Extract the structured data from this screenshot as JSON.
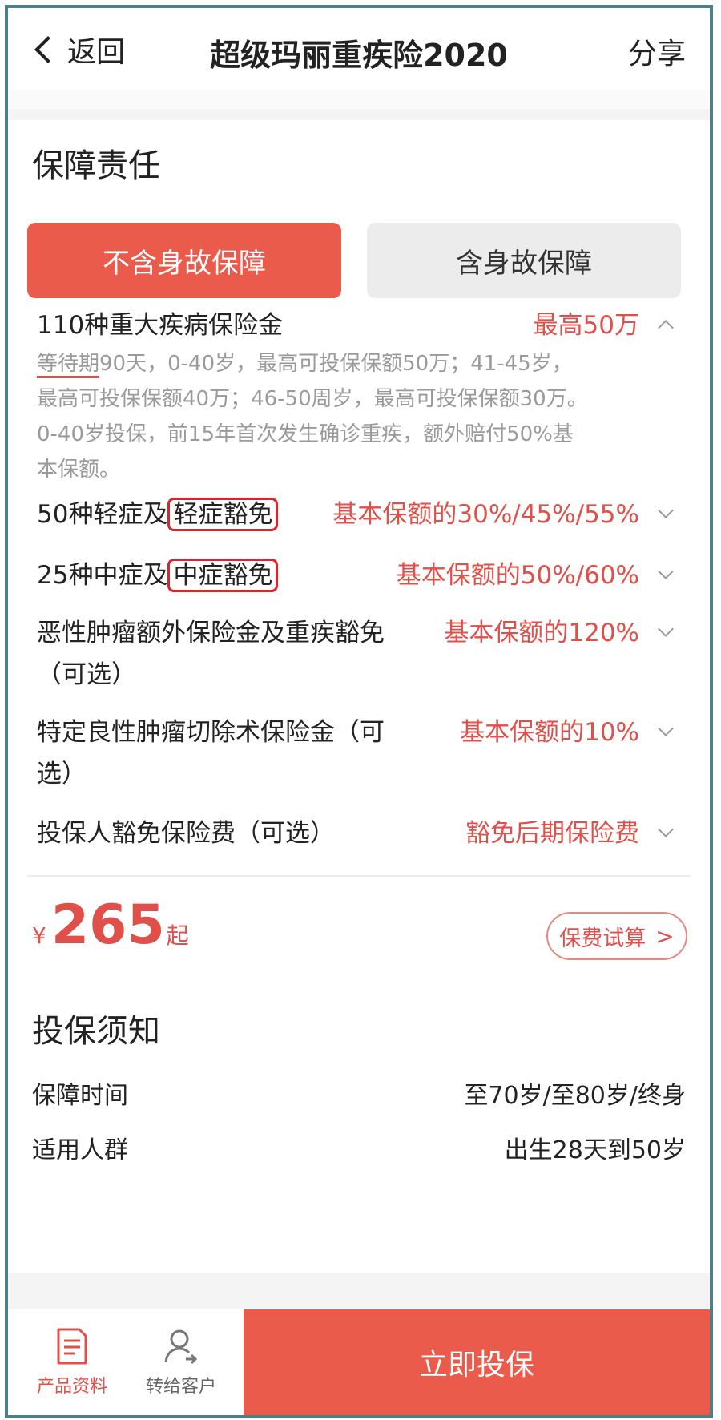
{
  "nav": {
    "back_label": "返回",
    "title": "超级玛丽重疾险2020",
    "share_label": "分享"
  },
  "coverage": {
    "title": "保障责任",
    "tabs": [
      "不含身故保障",
      "含身故保障"
    ],
    "items": [
      {
        "name": "110种重大疾病保险金",
        "value": "最高50万"
      },
      {
        "name_pre": "50种轻症及",
        "name_hl": "轻症豁免",
        "value": "基本保额的30%/45%/55%"
      },
      {
        "name_pre": "25种中症及",
        "name_hl": "中症豁免",
        "value": "基本保额的50%/60%"
      },
      {
        "name_l1": "恶性肿瘤额外保险金及重疾豁免",
        "name_l2": "（可选）",
        "value": "基本保额的120%"
      },
      {
        "name_l1": "特定良性肿瘤切除术保险金（可",
        "name_l2": "选）",
        "value": "基本保额的10%"
      },
      {
        "name": "投保人豁免保险费（可选）",
        "value": "豁免后期保险费"
      }
    ],
    "detail_underlined": "等待期",
    "detail_l1_rest": "90天，0-40岁，最高可投保保额50万；41-45岁，",
    "detail_l2": "最高可投保保额40万；46-50周岁，最高可投保保额30万。",
    "detail_l3": "0-40岁投保，前15年首次发生确诊重疾，额外赔付50%基",
    "detail_l4": "本保额。"
  },
  "price": {
    "currency": "¥",
    "amount": "265",
    "suffix": "起",
    "calc_label": "保费试算",
    "calc_arrow": ">"
  },
  "notice": {
    "title": "投保须知",
    "rows": [
      {
        "key": "保障时间",
        "value": "至70岁/至80岁/终身"
      },
      {
        "key": "适用人群",
        "value": "出生28天到50岁"
      }
    ]
  },
  "bottom": {
    "docs_label": "产品资料",
    "transfer_label": "转给客户",
    "buy_label": "立即投保"
  },
  "colors": {
    "accent": "#ea5b4c",
    "highlight_box": "#d8262b",
    "frame": "#4f7f84"
  }
}
